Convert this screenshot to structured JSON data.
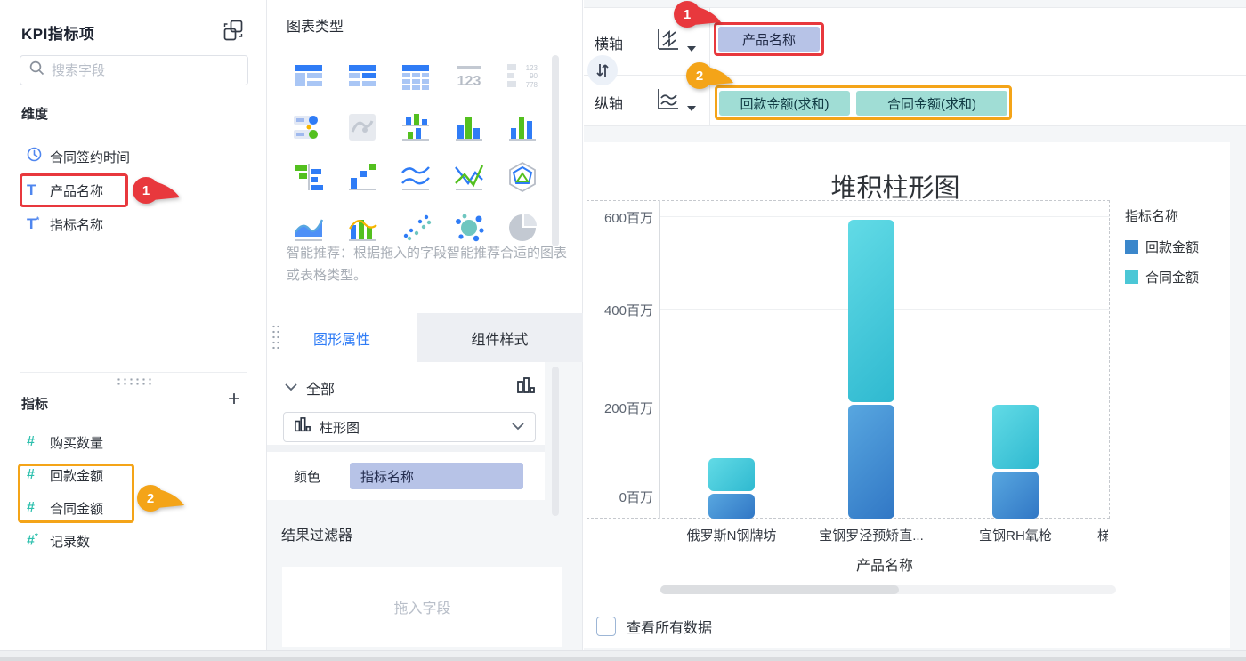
{
  "left_panel": {
    "title": "KPI指标项",
    "search_placeholder": "搜索字段",
    "dimensions": {
      "header": "维度",
      "items": [
        {
          "icon": "clock-icon",
          "label": "合同签约时间"
        },
        {
          "icon": "text-field-icon",
          "label": "产品名称",
          "highlight": "red"
        },
        {
          "icon": "text-calc-field-icon",
          "label": "指标名称"
        }
      ]
    },
    "measures": {
      "header": "指标",
      "items": [
        {
          "icon": "hash-icon",
          "label": "购买数量"
        },
        {
          "icon": "hash-icon",
          "label": "回款金额",
          "highlight": "orange"
        },
        {
          "icon": "hash-icon",
          "label": "合同金额",
          "highlight": "orange"
        },
        {
          "icon": "hash-calc-icon",
          "label": "记录数"
        }
      ]
    }
  },
  "chart_type_panel": {
    "title": "图表类型",
    "hint": "智能推荐：根据拖入的字段智能推荐合适的图表或表格类型。",
    "icon_names": [
      "table-detail",
      "table-group",
      "table-cross",
      "kpi-number",
      "kpi-card",
      "gantt",
      "map",
      "stacked-column-mini",
      "grouped-column",
      "column",
      "stacked-bar-horizontal",
      "step-scatter",
      "multi-line",
      "cross-line",
      "radar",
      "area",
      "combo-bar-line",
      "scatter",
      "bubble",
      "pie"
    ]
  },
  "properties_panel": {
    "tabs": [
      {
        "label": "图形属性"
      },
      {
        "label": "组件样式"
      }
    ],
    "active_tab": "图形属性",
    "group_label": "全部",
    "chart_select_value": "柱形图",
    "color_label": "颜色",
    "color_field": "指标名称",
    "filter_header": "结果过滤器",
    "filter_placeholder": "拖入字段"
  },
  "axes": {
    "x_label": "横轴",
    "x_fields": [
      "产品名称"
    ],
    "y_label": "纵轴",
    "y_fields": [
      "回款金额(求和)",
      "合同金额(求和)"
    ]
  },
  "annotations": {
    "badge1": "1",
    "badge2": "2",
    "red": "#e8383d",
    "orange": "#f4a418"
  },
  "chart_data": {
    "type": "bar",
    "stacked": true,
    "title": "堆积柱形图",
    "categories": [
      "俄罗斯N钢牌坊",
      "宝钢罗泾预矫直...",
      "宜钢RH氧枪"
    ],
    "partial_category": "梯",
    "series": [
      {
        "name": "回款金额",
        "color_from": "#58a7e0",
        "color_to": "#3177c5",
        "legend_color": "#3b87cb",
        "values": [
          53,
          244,
          101
        ]
      },
      {
        "name": "合同金额",
        "color_from": "#62dbe6",
        "color_to": "#2fb9d0",
        "legend_color": "#4bc7d6",
        "values": [
          77,
          396,
          143
        ]
      }
    ],
    "unit": "百万",
    "y_ticks": [
      "600百万",
      "400百万",
      "200百万",
      "0百万"
    ],
    "ylim": [
      0,
      600
    ],
    "xlabel": "产品名称",
    "legend_title": "指标名称",
    "legend_position": "right",
    "grid": true
  },
  "footer": {
    "checkbox_label": "查看所有数据",
    "checkbox_checked": false
  }
}
